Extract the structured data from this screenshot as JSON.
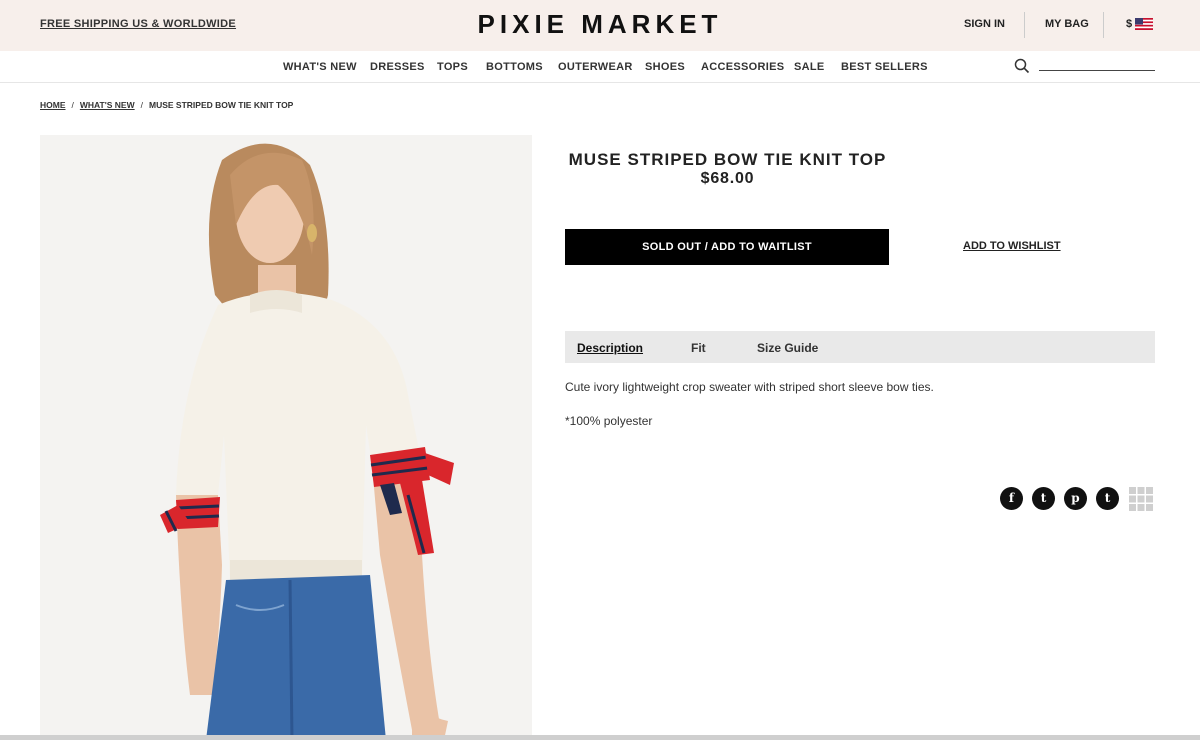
{
  "topbar": {
    "shipping": "FREE SHIPPING US & WORLDWIDE",
    "logo": "PIXIE MARKET",
    "sign_in": "SIGN IN",
    "my_bag": "MY BAG",
    "currency": "$"
  },
  "nav": {
    "items": [
      "WHAT'S NEW",
      "DRESSES",
      "TOPS",
      "BOTTOMS",
      "OUTERWEAR",
      "SHOES",
      "ACCESSORIES",
      "SALE",
      "BEST SELLERS"
    ],
    "search_placeholder": ""
  },
  "breadcrumb": [
    "HOME",
    "WHAT'S NEW",
    "MUSE STRIPED BOW TIE KNIT TOP"
  ],
  "product": {
    "title": "MUSE STRIPED BOW TIE KNIT TOP",
    "price": "$68.00",
    "sold_out_label": "SOLD OUT / ADD TO WAITLIST",
    "wishlist_label": "ADD TO WISHLIST"
  },
  "tabs": [
    "Description",
    "Fit",
    "Size Guide"
  ],
  "description": {
    "line1": "Cute ivory lightweight crop sweater with striped short sleeve bow ties.",
    "line2": "*100% polyester"
  },
  "social": {
    "facebook": "f",
    "twitter": "t",
    "pinterest": "p",
    "tumblr": "t"
  },
  "colors": {
    "topbar_bg": "#f7efeb",
    "button_bg": "#000000",
    "tab_bar_bg": "#e9e9e9",
    "bow_red": "#d9262c",
    "bow_navy": "#1f2a4d",
    "sweater": "#f5f1e8",
    "denim": "#3a6aa8"
  }
}
